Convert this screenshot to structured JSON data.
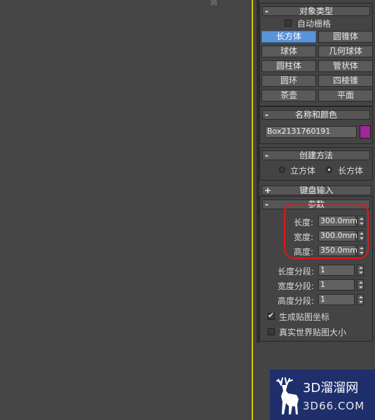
{
  "viewport": {
    "label": "简"
  },
  "object_type": {
    "title": "对象类型",
    "toggle": "-",
    "auto_grid_label": "自动栅格",
    "buttons": [
      "长方体",
      "圆锥体",
      "球体",
      "几何球体",
      "圆柱体",
      "管状体",
      "圆环",
      "四棱锥",
      "茶壶",
      "平面"
    ],
    "active_button": "长方体"
  },
  "name_color": {
    "title": "名称和颜色",
    "toggle": "-",
    "name_value": "Box2131760191",
    "swatch_color": "#a0249a"
  },
  "creation_method": {
    "title": "创建方法",
    "toggle": "-",
    "option_cube": "立方体",
    "option_box": "长方体",
    "selected": "长方体"
  },
  "keyboard_entry": {
    "title": "键盘输入",
    "toggle": "+"
  },
  "parameters": {
    "title": "参数",
    "toggle": "-",
    "length_label": "长度:",
    "length_value": "300.0mm",
    "width_label": "宽度:",
    "width_value": "300.0mm",
    "height_label": "高度:",
    "height_value": "350.0mm",
    "length_segs_label": "长度分段:",
    "length_segs_value": "1",
    "width_segs_label": "宽度分段:",
    "width_segs_value": "1",
    "height_segs_label": "高度分段:",
    "height_segs_value": "1",
    "gen_map_coords_label": "生成贴图坐标",
    "gen_map_coords_checked": true,
    "real_world_map_label": "真实世界贴图大小",
    "real_world_map_checked": false
  },
  "watermark": {
    "title": "3D溜溜网",
    "url": "3D66.COM"
  },
  "colors": {
    "highlight_ring": "#e01818",
    "active_button": "#5a94d8",
    "viewport_border": "#d8c400"
  }
}
